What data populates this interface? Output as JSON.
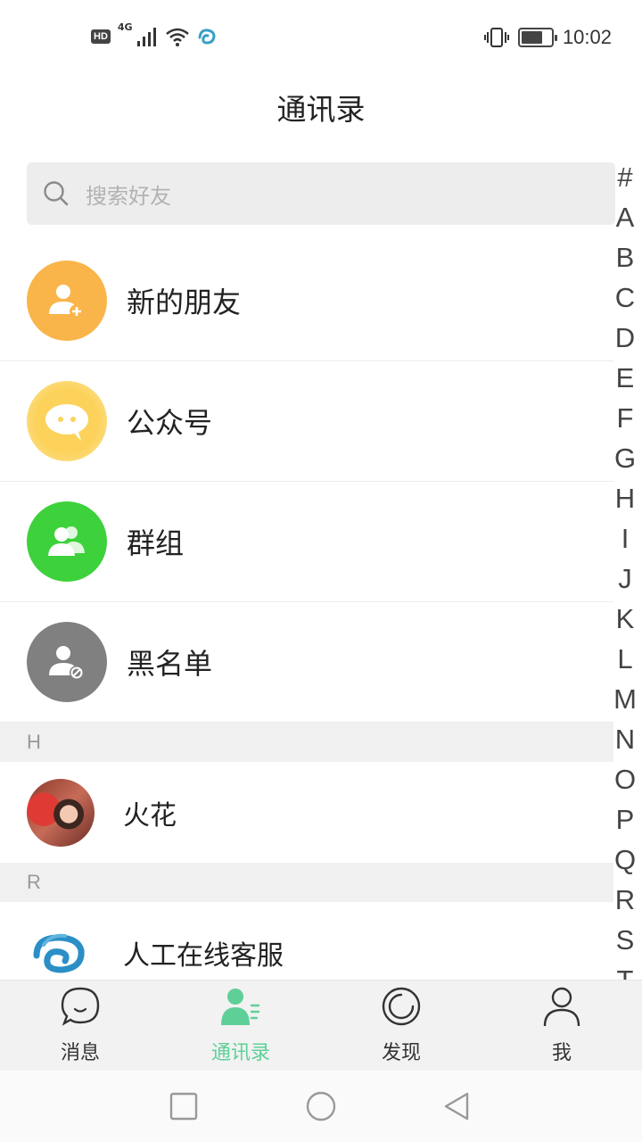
{
  "status_bar": {
    "hd": "HD",
    "network": "4G",
    "time": "10:02",
    "battery_level": 0.72,
    "icons": [
      "hd-icon",
      "signal-icon",
      "wifi-icon",
      "app-notification-icon",
      "vibrate-icon",
      "battery-icon"
    ]
  },
  "header": {
    "title": "通讯录"
  },
  "search": {
    "placeholder": "搜索好友"
  },
  "function_items": [
    {
      "label": "新的朋友",
      "icon": "add-user-icon",
      "color": "#f9b54a"
    },
    {
      "label": "公众号",
      "icon": "chat-bubble-icon",
      "color": "#fcd25a"
    },
    {
      "label": "群组",
      "icon": "group-icon",
      "color": "#3dd13b"
    },
    {
      "label": "黑名单",
      "icon": "block-user-icon",
      "color": "#808080"
    }
  ],
  "sections": [
    {
      "letter": "H",
      "contacts": [
        {
          "name": "火花",
          "avatar": "photo-avatar"
        }
      ]
    },
    {
      "letter": "R",
      "contacts": [
        {
          "name": "人工在线客服",
          "avatar": "service-logo-avatar"
        }
      ]
    }
  ],
  "letter_index": [
    "#",
    "A",
    "B",
    "C",
    "D",
    "E",
    "F",
    "G",
    "H",
    "I",
    "J",
    "K",
    "L",
    "M",
    "N",
    "O",
    "P",
    "Q",
    "R",
    "S",
    "T"
  ],
  "tabs": [
    {
      "label": "消息",
      "icon": "message-icon",
      "active": false
    },
    {
      "label": "通讯录",
      "icon": "contacts-icon",
      "active": true
    },
    {
      "label": "发现",
      "icon": "discover-icon",
      "active": false
    },
    {
      "label": "我",
      "icon": "profile-icon",
      "active": false
    }
  ],
  "colors": {
    "accent": "#5fcf98",
    "search_bg": "#ededed",
    "section_bg": "#f0f0f0",
    "tab_bar_bg": "#f2f2f2"
  },
  "nav_bar": {
    "buttons": [
      "recent-apps-button",
      "home-button",
      "back-button"
    ]
  }
}
